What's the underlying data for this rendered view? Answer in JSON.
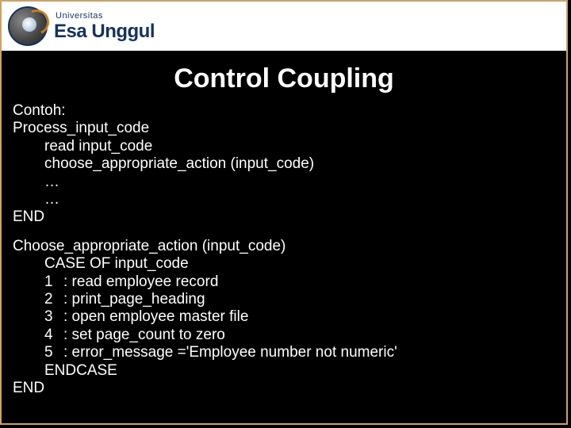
{
  "header": {
    "small": "Universitas",
    "big": "Esa Unggul"
  },
  "title": "Control Coupling",
  "block1": {
    "l0": "Contoh:",
    "l1": "Process_input_code",
    "l2": "read input_code",
    "l3": "choose_appropriate_action (input_code)",
    "l4": "…",
    "l5": "…",
    "l6": "END"
  },
  "block2": {
    "l0": "Choose_appropriate_action (input_code)",
    "l1": "CASE OF input_code",
    "c1n": "1",
    "c1t": ": read employee record",
    "c2n": "2",
    "c2t": ": print_page_heading",
    "c3n": "3",
    "c3t": ": open employee master file",
    "c4n": "4",
    "c4t": ": set page_count to zero",
    "c5n": "5",
    "c5t": ": error_message ='Employee number not numeric'",
    "l7": "ENDCASE",
    "l8": "END"
  }
}
